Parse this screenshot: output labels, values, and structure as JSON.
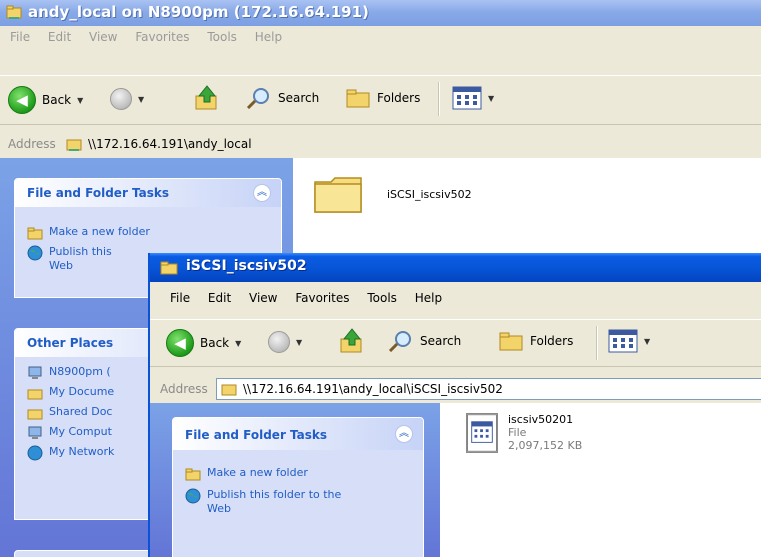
{
  "back_window": {
    "title": "andy_local on N8900pm (172.16.64.191)",
    "menu": [
      "File",
      "Edit",
      "View",
      "Favorites",
      "Tools",
      "Help"
    ],
    "toolbar": {
      "back": "Back",
      "search": "Search",
      "folders": "Folders"
    },
    "address_label": "Address",
    "address_value": "\\\\172.16.64.191\\andy_local",
    "file_folder_tasks": {
      "header": "File and Folder Tasks",
      "items": [
        "Make a new folder",
        "Publish this",
        "Web"
      ]
    },
    "other_places": {
      "header": "Other Places",
      "items": [
        "N8900pm (",
        "My Docume",
        "Shared Doc",
        "My Comput",
        "My Network"
      ]
    },
    "folder_name": "iSCSI_iscsiv502"
  },
  "front_window": {
    "title": "iSCSI_iscsiv502",
    "menu": [
      "File",
      "Edit",
      "View",
      "Favorites",
      "Tools",
      "Help"
    ],
    "toolbar": {
      "back": "Back",
      "search": "Search",
      "folders": "Folders"
    },
    "address_label": "Address",
    "address_value": "\\\\172.16.64.191\\andy_local\\iSCSI_iscsiv502",
    "file_folder_tasks": {
      "header": "File and Folder Tasks",
      "items": [
        "Make a new folder",
        "Publish this folder to the",
        "Web"
      ]
    },
    "file": {
      "name": "iscsiv50201",
      "type": "File",
      "size": "2,097,152 KB"
    }
  },
  "colors": {
    "accent_title": "#0856d8",
    "link": "#215dc6",
    "pane": "#6f8fe0"
  },
  "icons": [
    "folder-icon",
    "back-arrow-icon",
    "forward-arrow-icon",
    "up-folder-icon",
    "search-icon",
    "folders-icon",
    "views-icon",
    "globe-icon",
    "computer-icon",
    "network-icon"
  ]
}
